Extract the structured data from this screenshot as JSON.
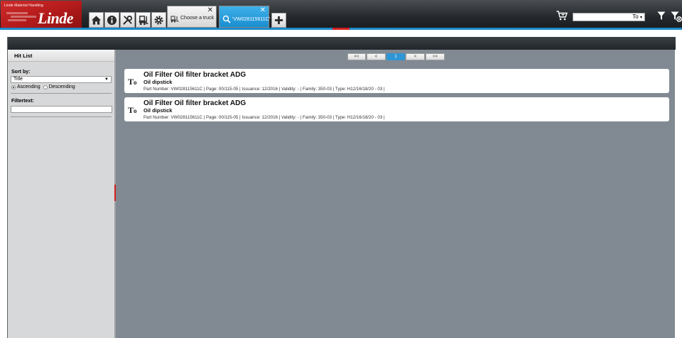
{
  "app": {
    "logo_tagline": "Linde Material Handling",
    "logo_word": "Linde"
  },
  "toolbar": {
    "nav_icons": [
      "home-icon",
      "info-icon",
      "tools-icon",
      "forklift-catalog-icon",
      "gear-icon"
    ]
  },
  "tabs": [
    {
      "label": "Choose a truck",
      "icon": "truck-icon",
      "close": "✕"
    },
    {
      "label": "'VW028115611C'",
      "icon": "search-icon",
      "close": "✕"
    }
  ],
  "add_tab_label": "+",
  "header_search": {
    "value": "To"
  },
  "colors": {
    "accent_blue": "#1c8ac9",
    "brand_red": "#c0201f",
    "panel_gray": "#818a92"
  },
  "left_panel": {
    "title": "Hit List",
    "sort_label": "Sort by:",
    "sort_value": "Title",
    "sort_arrow": "▼",
    "ascending_label": "Ascending",
    "descending_label": "Descending",
    "filter_label": "Filtertext:",
    "filter_value": ""
  },
  "pager": {
    "first": "<<",
    "prev": "<",
    "current": "1",
    "next": ">",
    "last": ">>"
  },
  "results": [
    {
      "icon_text": "T",
      "icon_suffix": "o",
      "title": "Oil Filter Oil filter bracket ADG",
      "subtitle": "Oil dipstick",
      "meta": "Part Number: VW028115611C |  Page: 00/115-05 |  Issuance: 12/2016 |  Validity:  - |  Family: 350-03 |  Type: H12/16/18/20 - 03 |"
    },
    {
      "icon_text": "T",
      "icon_suffix": "o",
      "title": "Oil Filter Oil filter bracket ADG",
      "subtitle": "Oil dipstick",
      "meta": "Part Number: VW028115611C |  Page: 00/115-05 |  Issuance: 12/2016 |  Validity:  - |  Family: 350-03 |  Type: H12/16/18/20 - 03 |"
    }
  ]
}
